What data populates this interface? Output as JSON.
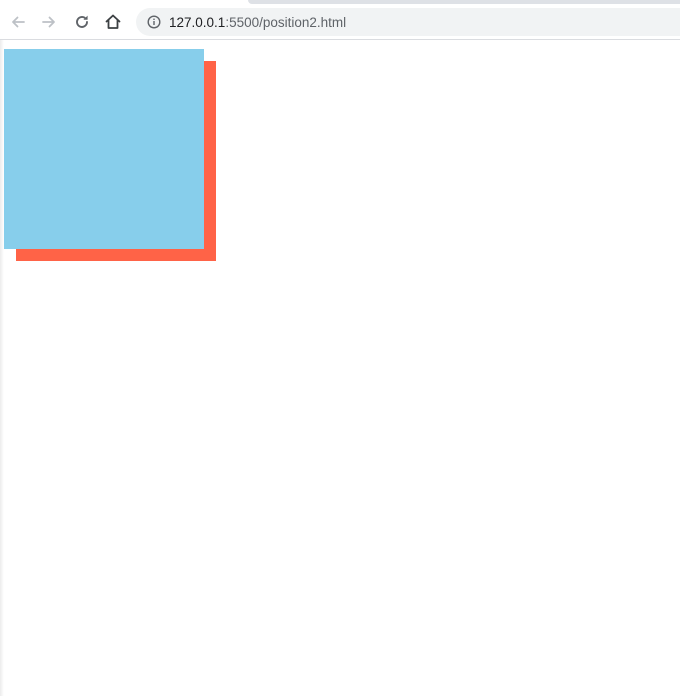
{
  "browser": {
    "url": {
      "host": "127.0.0.1",
      "rest": ":5500/position2.html"
    },
    "icons": {
      "back": "arrow-left-icon",
      "forward": "arrow-right-icon",
      "reload": "reload-icon",
      "home": "home-icon",
      "site_info": "info-icon"
    }
  },
  "page": {
    "boxes": [
      {
        "name": "red-box",
        "color": "#ff6347"
      },
      {
        "name": "blue-box",
        "color": "#87ceeb"
      }
    ]
  },
  "colors": {
    "nav_disabled": "#bdc1c6",
    "nav_enabled": "#5f6368",
    "omnibox_bg": "#f1f3f4"
  }
}
